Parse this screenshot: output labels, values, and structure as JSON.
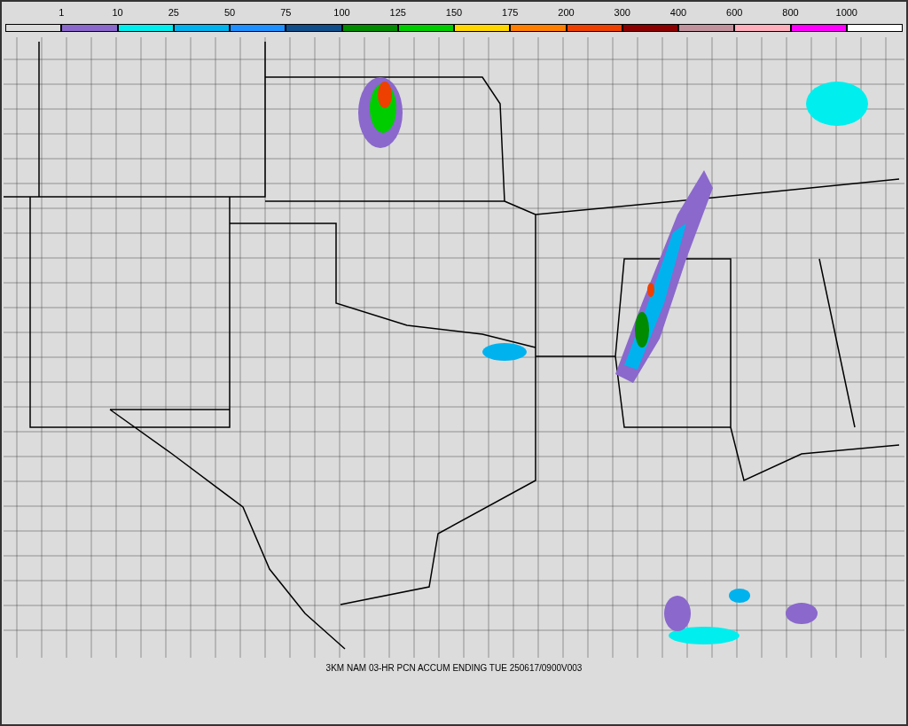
{
  "legend": {
    "labels": [
      "1",
      "10",
      "25",
      "50",
      "75",
      "100",
      "125",
      "150",
      "175",
      "200",
      "300",
      "400",
      "600",
      "800",
      "1000"
    ],
    "swatches": [
      {
        "color": "#dcdcdc"
      },
      {
        "color": "#8a68cc"
      },
      {
        "color": "#00eeee"
      },
      {
        "color": "#00b2ee"
      },
      {
        "color": "#1e90ff"
      },
      {
        "color": "#104e8b"
      },
      {
        "color": "#008b00"
      },
      {
        "color": "#00cd00"
      },
      {
        "color": "#ffd700"
      },
      {
        "color": "#ff7f00"
      },
      {
        "color": "#ee4000"
      },
      {
        "color": "#8b0000"
      },
      {
        "color": "#c1929b"
      },
      {
        "color": "#ffaebb"
      },
      {
        "color": "#ff00ff"
      },
      {
        "color": "#ffffff"
      }
    ]
  },
  "caption": "3KM NAM 03-HR PCN ACCUM ENDING TUE 250617/0900V003"
}
